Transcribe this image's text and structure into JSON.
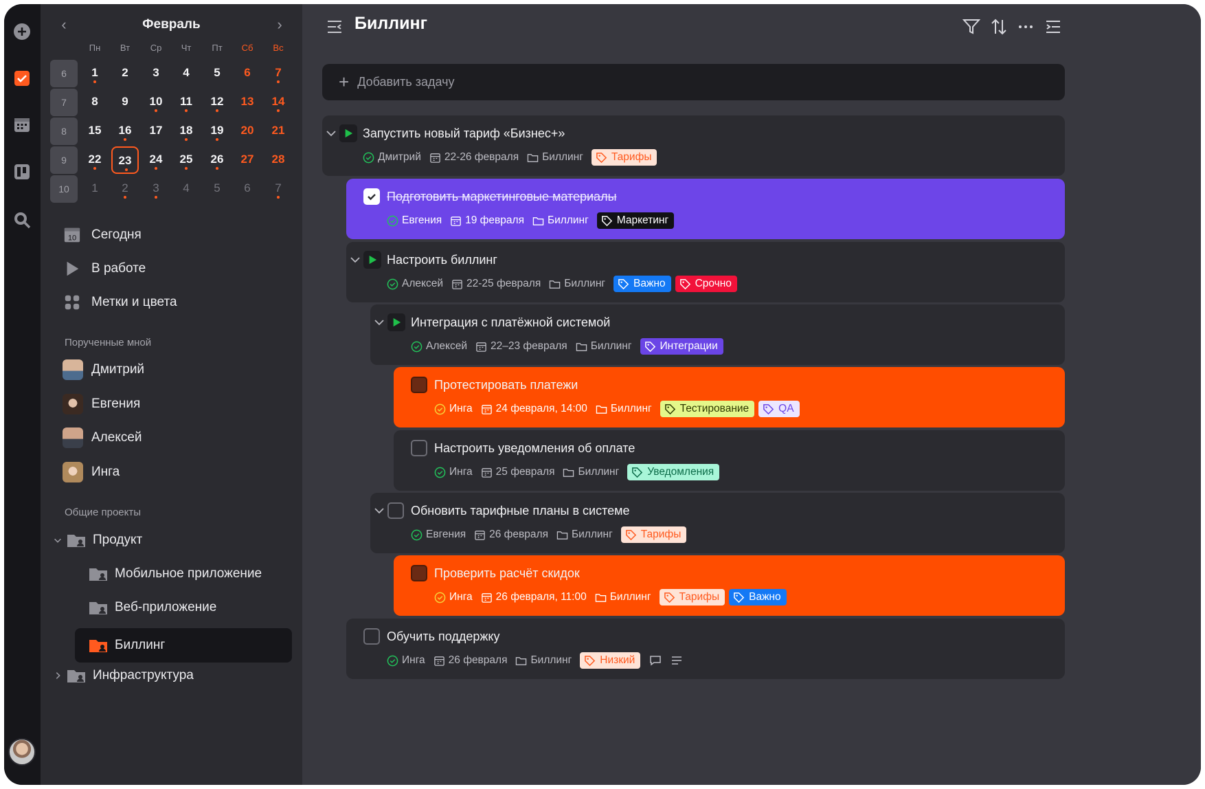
{
  "calendar": {
    "month": "Февраль",
    "weekdays": [
      "Пн",
      "Вт",
      "Ср",
      "Чт",
      "Пт",
      "Сб",
      "Вс"
    ],
    "weeks": [
      {
        "num": "6",
        "days": [
          {
            "d": "1",
            "t": "n",
            "dot": true
          },
          {
            "d": "2",
            "t": "n"
          },
          {
            "d": "3",
            "t": "n"
          },
          {
            "d": "4",
            "t": "n"
          },
          {
            "d": "5",
            "t": "n"
          },
          {
            "d": "6",
            "t": "we"
          },
          {
            "d": "7",
            "t": "we",
            "dot": true
          }
        ]
      },
      {
        "num": "7",
        "days": [
          {
            "d": "8",
            "t": "n"
          },
          {
            "d": "9",
            "t": "n"
          },
          {
            "d": "10",
            "t": "n",
            "dot": true
          },
          {
            "d": "11",
            "t": "n",
            "dot": true
          },
          {
            "d": "12",
            "t": "n",
            "dot": true
          },
          {
            "d": "13",
            "t": "we"
          },
          {
            "d": "14",
            "t": "we",
            "dot": true
          }
        ]
      },
      {
        "num": "8",
        "days": [
          {
            "d": "15",
            "t": "n"
          },
          {
            "d": "16",
            "t": "n",
            "dot": true
          },
          {
            "d": "17",
            "t": "n"
          },
          {
            "d": "18",
            "t": "n",
            "dot": true
          },
          {
            "d": "19",
            "t": "n",
            "dot": true
          },
          {
            "d": "20",
            "t": "we"
          },
          {
            "d": "21",
            "t": "we"
          }
        ]
      },
      {
        "num": "9",
        "days": [
          {
            "d": "22",
            "t": "n",
            "dot": true
          },
          {
            "d": "23",
            "t": "today",
            "dot": true
          },
          {
            "d": "24",
            "t": "n",
            "dot": true
          },
          {
            "d": "25",
            "t": "n",
            "dot": true
          },
          {
            "d": "26",
            "t": "n",
            "dot": true
          },
          {
            "d": "27",
            "t": "we"
          },
          {
            "d": "28",
            "t": "we"
          }
        ]
      },
      {
        "num": "10",
        "days": [
          {
            "d": "1",
            "t": "other"
          },
          {
            "d": "2",
            "t": "other",
            "dot": true
          },
          {
            "d": "3",
            "t": "other",
            "dot": true
          },
          {
            "d": "4",
            "t": "other"
          },
          {
            "d": "5",
            "t": "other"
          },
          {
            "d": "6",
            "t": "other"
          },
          {
            "d": "7",
            "t": "other",
            "dot": true
          }
        ]
      }
    ]
  },
  "nav": {
    "today_icon_num": "10",
    "today": "Сегодня",
    "in_progress": "В работе",
    "tags": "Метки и цвета"
  },
  "assigned": {
    "label": "Порученные мной",
    "people": [
      "Дмитрий",
      "Евгения",
      "Алексей",
      "Инга"
    ]
  },
  "projects": {
    "label": "Общие проекты",
    "product": "Продукт",
    "mobile": "Мобильное приложение",
    "web": "Веб-приложение",
    "billing": "Биллинг",
    "infra": "Инфраструктура"
  },
  "main": {
    "title": "Биллинг",
    "add_task_placeholder": "Добавить задачу"
  },
  "tasks": [
    {
      "title": "Запустить новый тариф «Бизнес+»",
      "user": "Дмитрий",
      "date": "22-26 февраля",
      "project": "Биллинг",
      "tags": [
        {
          "label": "Тарифы",
          "bg": "#ffe3d6",
          "fg": "#ff5a1f"
        }
      ]
    },
    {
      "title": "Подготовить маркетинговые материалы",
      "user": "Евгения",
      "date": "19 февраля",
      "project": "Биллинг",
      "tags": [
        {
          "label": "Маркетинг",
          "bg": "#111114",
          "fg": "#ffffff"
        }
      ]
    },
    {
      "title": "Настроить биллинг",
      "user": "Алексей",
      "date": "22-25 февраля",
      "project": "Биллинг",
      "tags": [
        {
          "label": "Важно",
          "bg": "#1479f5",
          "fg": "#ffffff"
        },
        {
          "label": "Срочно",
          "bg": "#f2123a",
          "fg": "#ffffff"
        }
      ]
    },
    {
      "title": "Интеграция с платёжной системой",
      "user": "Алексей",
      "date": "22–23 февраля",
      "project": "Биллинг",
      "tags": [
        {
          "label": "Интеграции",
          "bg": "#6a45e6",
          "fg": "#ffffff"
        }
      ]
    },
    {
      "title": "Протестировать платежи",
      "user": "Инга",
      "date": "24 февраля, 14:00",
      "project": "Биллинг",
      "tags": [
        {
          "label": "Тестирование",
          "bg": "#e4f78a",
          "fg": "#2f3b00"
        },
        {
          "label": "QA",
          "bg": "#ece6ff",
          "fg": "#6a45e6"
        }
      ]
    },
    {
      "title": "Настроить уведомления об оплате",
      "user": "Инга",
      "date": "25 февраля",
      "project": "Биллинг",
      "tags": [
        {
          "label": "Уведомления",
          "bg": "#a8f5d8",
          "fg": "#0b6b48"
        }
      ]
    },
    {
      "title": "Обновить тарифные планы в системе",
      "user": "Евгения",
      "date": "26 февраля",
      "project": "Биллинг",
      "tags": [
        {
          "label": "Тарифы",
          "bg": "#ffe3d6",
          "fg": "#ff5a1f"
        }
      ]
    },
    {
      "title": "Проверить расчёт скидок",
      "user": "Инга",
      "date": "26 февраля, 11:00",
      "project": "Биллинг",
      "tags": [
        {
          "label": "Тарифы",
          "bg": "#ffe3d6",
          "fg": "#ff5a1f"
        },
        {
          "label": "Важно",
          "bg": "#1479f5",
          "fg": "#ffffff"
        }
      ]
    },
    {
      "title": "Обучить поддержку",
      "user": "Инга",
      "date": "26 февраля",
      "project": "Биллинг",
      "tags": [
        {
          "label": "Низкий",
          "bg": "#ffe3d6",
          "fg": "#ff5a1f"
        }
      ]
    }
  ],
  "colors": {
    "accent": "#ff5a1f",
    "purple": "#6d45e8",
    "orange": "#ff4d00",
    "bg": "#38383f"
  }
}
